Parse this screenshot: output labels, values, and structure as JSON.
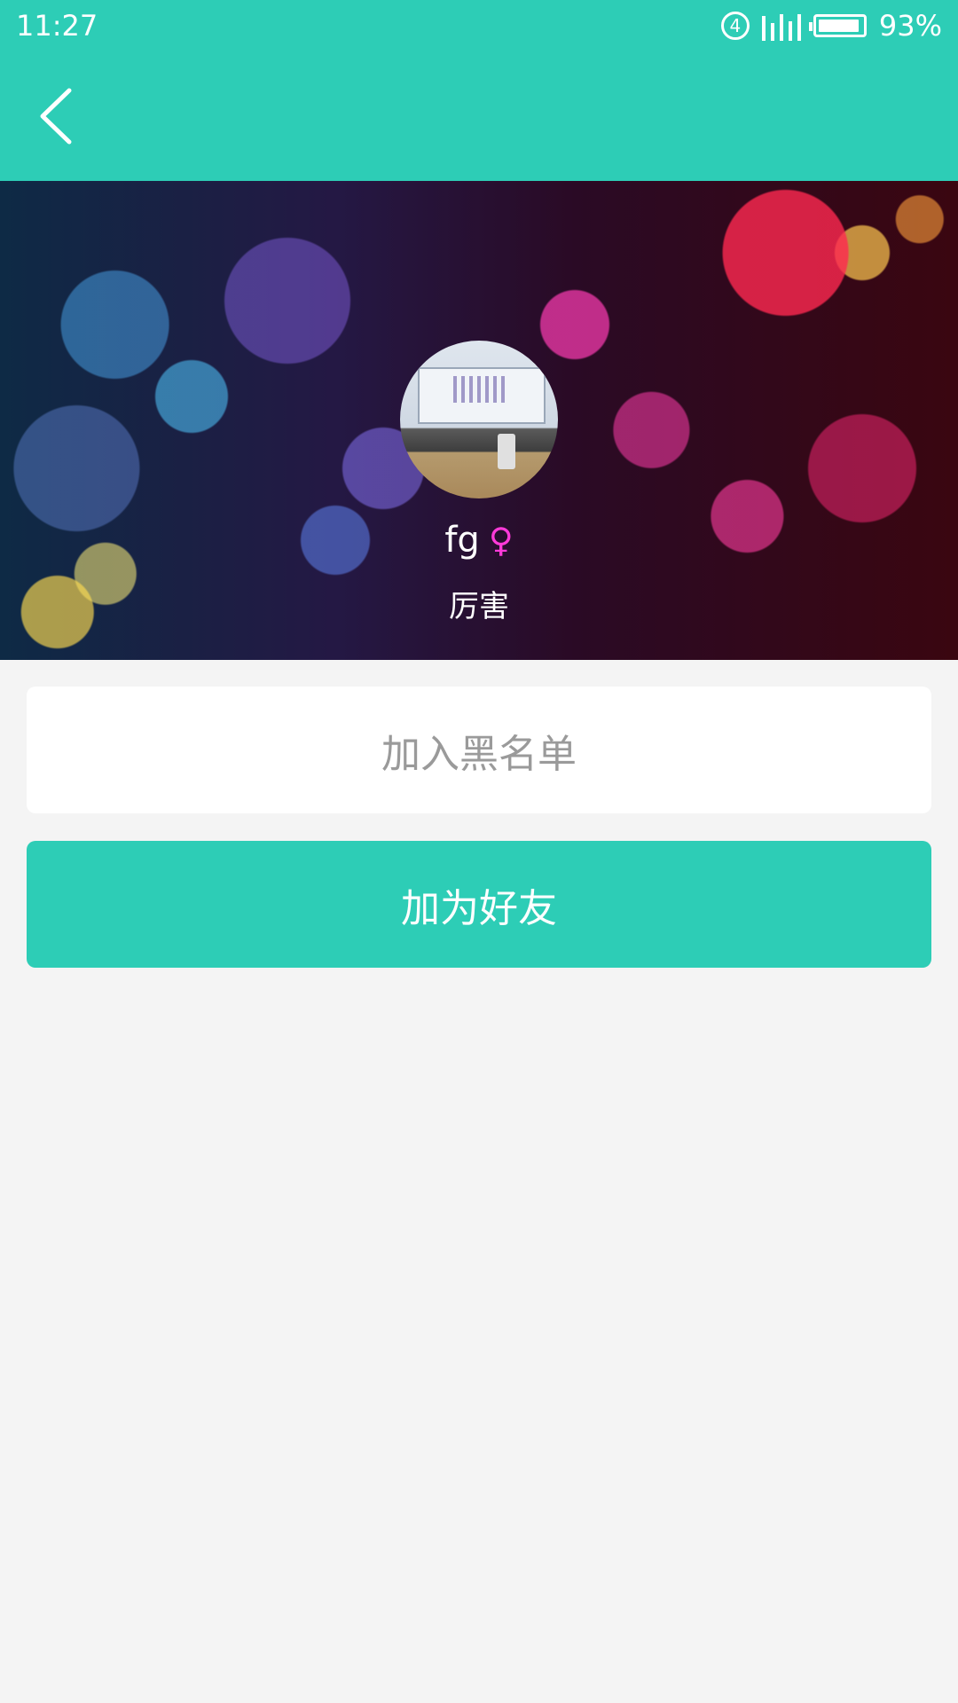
{
  "status_bar": {
    "time": "11:27",
    "network_badge": "4",
    "battery_percent": "93%",
    "battery_level": 0.93
  },
  "colors": {
    "accent": "#2dcdb6",
    "gender_female": "#ff3ad9",
    "background": "#f4f4f4"
  },
  "header": {
    "back_icon": "chevron-left-icon"
  },
  "profile": {
    "name": "fg",
    "gender_symbol": "♀",
    "signature": "厉害"
  },
  "actions": {
    "blacklist_label": "加入黑名单",
    "add_friend_label": "加为好友"
  }
}
